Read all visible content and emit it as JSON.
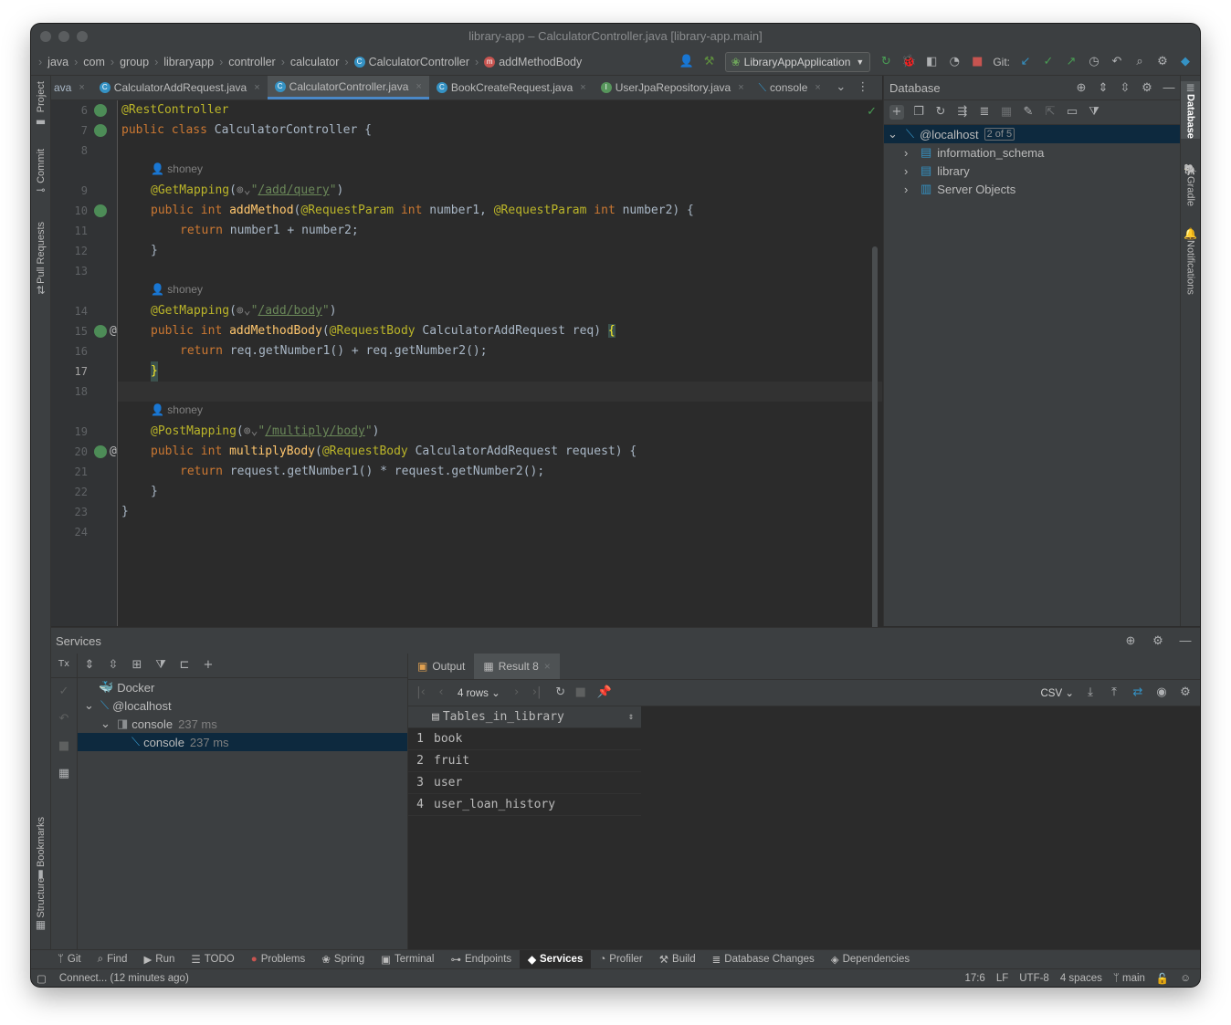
{
  "window": {
    "title": "library-app – CalculatorController.java [library-app.main]"
  },
  "breadcrumbs": [
    "java",
    "com",
    "group",
    "libraryapp",
    "controller",
    "calculator",
    "CalculatorController",
    "addMethodBody"
  ],
  "run_config": {
    "label": "LibraryAppApplication"
  },
  "git": {
    "label": "Git:"
  },
  "left_tool_tabs": [
    "Project",
    "Commit",
    "Pull Requests",
    "Bookmarks",
    "Structure"
  ],
  "right_tool_tabs": [
    "Database",
    "Gradle",
    "Notifications"
  ],
  "editor_tabs": [
    {
      "label": "ava",
      "type": "partial"
    },
    {
      "label": "CalculatorAddRequest.java",
      "type": "class"
    },
    {
      "label": "CalculatorController.java",
      "type": "class",
      "active": true
    },
    {
      "label": "BookCreateRequest.java",
      "type": "class"
    },
    {
      "label": "UserJpaRepository.java",
      "type": "interface"
    },
    {
      "label": "console",
      "type": "console"
    }
  ],
  "editor": {
    "author": "shoney",
    "line_numbers": [
      "6",
      "7",
      "8",
      "9",
      "10",
      "11",
      "12",
      "13",
      "14",
      "15",
      "16",
      "17",
      "18",
      "19",
      "20",
      "21",
      "22",
      "23",
      "24"
    ],
    "code": {
      "l6_ann": "@RestController",
      "l7_kw": "public class ",
      "l7_rest": "CalculatorController {",
      "l9_ann": "@GetMapping",
      "l9_path": "/add/query",
      "l10_kw": "public int ",
      "l10_fn": "addMethod",
      "l10_p1": "@RequestParam",
      "l10_t1": " int ",
      "l10_n1": "number1, ",
      "l10_p2": "@RequestParam",
      "l10_t2": " int ",
      "l10_n2": "number2) {",
      "l11_kw": "return ",
      "l11_rest": "number1 + number2;",
      "l12": "}",
      "l14_ann": "@GetMapping",
      "l14_path": "/add/body",
      "l15_kw": "public int ",
      "l15_fn": "addMethodBody",
      "l15_p": "@RequestBody",
      "l15_rest": " CalculatorAddRequest req) ",
      "l15_brace": "{",
      "l16_kw": "return ",
      "l16_rest": "req.getNumber1() + req.getNumber2();",
      "l17": "}",
      "l19_ann": "@PostMapping",
      "l19_path": "/multiply/body",
      "l20_kw": "public int ",
      "l20_fn": "multiplyBody",
      "l20_p": "@RequestBody",
      "l20_rest": " CalculatorAddRequest request) {",
      "l21_kw": "return ",
      "l21_rest": "request.getNumber1() * request.getNumber2();",
      "l22": "}",
      "l23": "}"
    }
  },
  "database": {
    "title": "Database",
    "root": {
      "label": "@localhost",
      "badge": "2 of 5"
    },
    "children": [
      "information_schema",
      "library",
      "Server Objects"
    ]
  },
  "services": {
    "title": "Services",
    "tree": {
      "docker": "Docker",
      "localhost": "@localhost",
      "console_group": "console",
      "console_group_time": "237 ms",
      "console": "console",
      "console_time": "237 ms"
    },
    "result_tabs": [
      "Output",
      "Result 8"
    ],
    "rows_label": "4 rows",
    "export_label": "CSV",
    "table": {
      "column": "Tables_in_library",
      "rows": [
        {
          "n": "1",
          "value": "book"
        },
        {
          "n": "2",
          "value": "fruit"
        },
        {
          "n": "3",
          "value": "user"
        },
        {
          "n": "4",
          "value": "user_loan_history"
        }
      ]
    }
  },
  "bottom_tabs": [
    "Git",
    "Find",
    "Run",
    "TODO",
    "Problems",
    "Spring",
    "Terminal",
    "Endpoints",
    "Services",
    "Profiler",
    "Build",
    "Database Changes",
    "Dependencies"
  ],
  "status": {
    "message": "Connect... (12 minutes ago)",
    "position": "17:6",
    "line_sep": "LF",
    "encoding": "UTF-8",
    "indent": "4 spaces",
    "branch": "main"
  }
}
